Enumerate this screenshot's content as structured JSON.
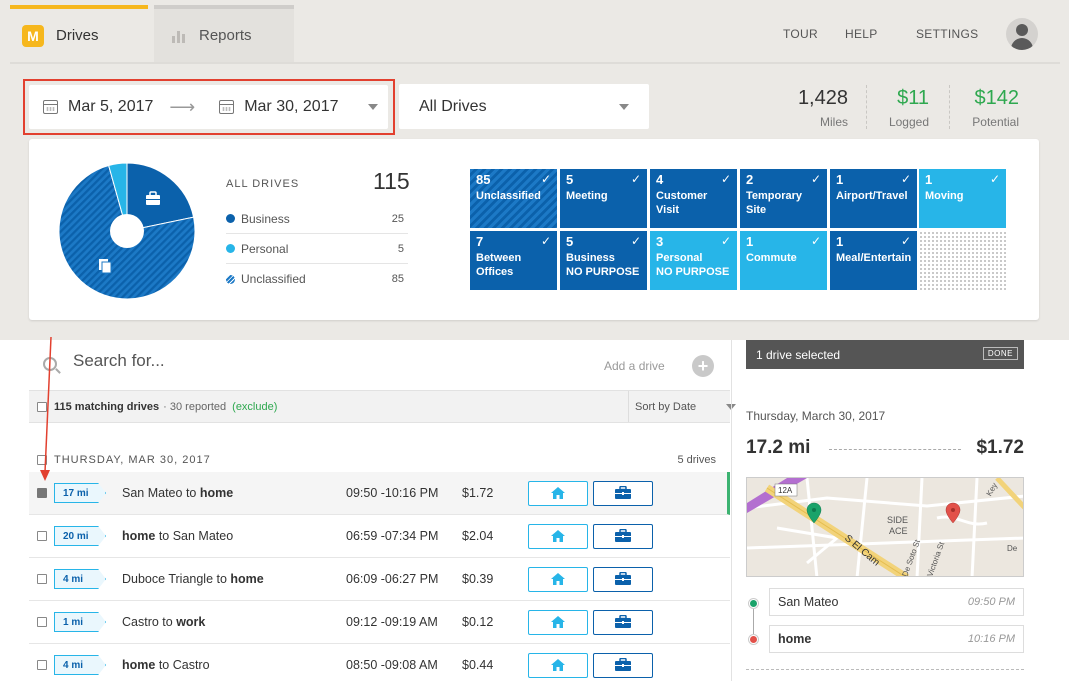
{
  "nav": {
    "tabs": [
      {
        "label": "Drives",
        "icon": "m-logo-icon"
      },
      {
        "label": "Reports",
        "icon": "bar-chart-icon"
      }
    ],
    "logo_letter": "M",
    "links": [
      "TOUR",
      "HELP",
      "SETTINGS"
    ]
  },
  "filters": {
    "start_date": "Mar 5, 2017",
    "arrow": "⟶",
    "end_date": "Mar 30, 2017",
    "drive_filter": "All Drives"
  },
  "stats": [
    {
      "value": "1,428",
      "label": "Miles",
      "color": "#333333"
    },
    {
      "value": "$11",
      "label": "Logged",
      "color": "#2ea84f"
    },
    {
      "value": "$142",
      "label": "Potential",
      "color": "#2ea84f"
    }
  ],
  "summary": {
    "title": "ALL DRIVES",
    "total": "115",
    "legend": [
      {
        "label": "Business",
        "count": "25",
        "color": "#0b61ab"
      },
      {
        "label": "Personal",
        "count": "5",
        "color": "#27b5e8"
      },
      {
        "label": "Unclassified",
        "count": "85",
        "color": "#1c79c6"
      }
    ],
    "pie": {
      "business": 25,
      "personal": 5,
      "unclassified": 85
    }
  },
  "tiles": [
    {
      "count": "85",
      "label": "Unclassified",
      "label2": "",
      "style": "striped"
    },
    {
      "count": "5",
      "label": "Meeting",
      "label2": "",
      "style": "dark"
    },
    {
      "count": "4",
      "label": "Customer",
      "label2": "Visit",
      "style": "dark"
    },
    {
      "count": "2",
      "label": "Temporary",
      "label2": "Site",
      "style": "dark"
    },
    {
      "count": "1",
      "label": "Airport/Travel",
      "label2": "",
      "style": "dark"
    },
    {
      "count": "1",
      "label": "Moving",
      "label2": "",
      "style": "light"
    },
    {
      "count": "7",
      "label": "Between",
      "label2": "Offices",
      "style": "dark"
    },
    {
      "count": "5",
      "label": "Business",
      "label2": "NO PURPOSE",
      "style": "dark"
    },
    {
      "count": "3",
      "label": "Personal",
      "label2": "NO PURPOSE",
      "style": "light"
    },
    {
      "count": "1",
      "label": "Commute",
      "label2": "",
      "style": "light"
    },
    {
      "count": "1",
      "label": "Meal/Entertain",
      "label2": "",
      "style": "dark"
    }
  ],
  "list": {
    "search_placeholder": "Search for...",
    "add_drive": "Add a drive",
    "matching": "115 matching drives",
    "reported": "· 30 reported",
    "exclude": "(exclude)",
    "sort": "Sort by Date",
    "day_label": "THURSDAY, MAR 30, 2017",
    "day_count": "5 drives",
    "rows": [
      {
        "distance": "17 mi",
        "from": "San Mateo",
        "to_word": " to ",
        "to": "home",
        "bold": "to",
        "time": "09:50 -10:16 PM",
        "amount": "$1.72",
        "selected": true
      },
      {
        "distance": "20 mi",
        "from": "home",
        "to_word": " to ",
        "to": "San Mateo",
        "bold": "from",
        "time": "06:59 -07:34 PM",
        "amount": "$2.04",
        "selected": false
      },
      {
        "distance": "4 mi",
        "from": "Duboce Triangle",
        "to_word": " to ",
        "to": "home",
        "bold": "to",
        "time": "06:09 -06:27 PM",
        "amount": "$0.39",
        "selected": false
      },
      {
        "distance": "1 mi",
        "from": "Castro",
        "to_word": " to ",
        "to": "work",
        "bold": "to",
        "time": "09:12 -09:19 AM",
        "amount": "$0.12",
        "selected": false
      },
      {
        "distance": "4 mi",
        "from": "home",
        "to_word": " to ",
        "to": "Castro",
        "bold": "from",
        "time": "08:50 -09:08 AM",
        "amount": "$0.44",
        "selected": false
      }
    ]
  },
  "detail": {
    "selected_text": "1 drive selected",
    "done": "DONE",
    "date": "Thursday, March 30, 2017",
    "distance": "17.2 mi",
    "amount": "$1.72",
    "map_labels": [
      "12A",
      "SIDE",
      "ACE",
      "S El Cam",
      "Victoria St",
      "De Soto St",
      "Key",
      "De"
    ],
    "waypoints": [
      {
        "place": "San Mateo",
        "time": "09:50 PM",
        "color": "#1aa36a"
      },
      {
        "place": "home",
        "time": "10:16 PM",
        "color": "#e2514a"
      }
    ]
  }
}
